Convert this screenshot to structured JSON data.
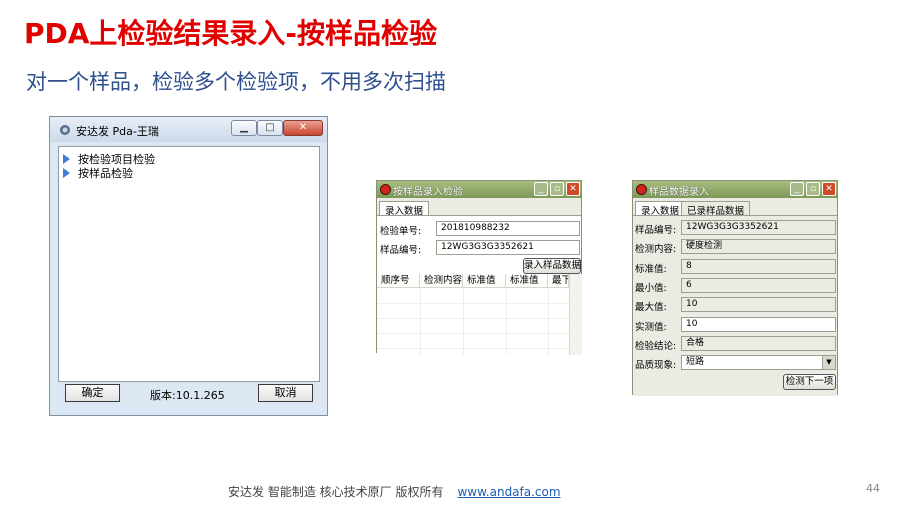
{
  "slide": {
    "title": "PDA上检验结果录入-按样品检验",
    "subtitle": "对一个样品，检验多个检验项，不用多次扫描",
    "footer_text": "安达发   智能制造 核心技术原厂   版权所有",
    "footer_link": "www.andafa.com",
    "page_number": "44"
  },
  "main_window": {
    "title": "安达发 Pda-王瑞",
    "menu_items": [
      {
        "label": "按检验项目检验"
      },
      {
        "label": "按样品检验"
      }
    ],
    "ok_button": "确定",
    "version": "版本:10.1.265",
    "cancel_button": "取消"
  },
  "sample_window": {
    "title": "按样品录入检验",
    "tab_entry": "录入数据",
    "inspection_no_label": "检验单号:",
    "inspection_no_value": "201810988232",
    "sample_no_label": "样品编号:",
    "sample_no_value": "12WG3G3G3352621",
    "entry_button": "录入样品数据",
    "grid_headers": [
      "顺序号",
      "检测内容",
      "标准值",
      "标准值",
      "最下"
    ]
  },
  "data_window": {
    "title": "样品数据录入",
    "tab_entry": "录入数据",
    "tab_entered": "已录样品数据",
    "fields": [
      {
        "label": "样品编号:",
        "value": "12WG3G3G3352621",
        "editable": false
      },
      {
        "label": "检测内容:",
        "value": "硬度检测",
        "editable": false
      },
      {
        "label": "标准值:",
        "value": "8",
        "editable": false
      },
      {
        "label": "最小值:",
        "value": "6",
        "editable": false
      },
      {
        "label": "最大值:",
        "value": "10",
        "editable": false
      },
      {
        "label": "实测值:",
        "value": "10",
        "editable": true
      },
      {
        "label": "检验结论:",
        "value": "合格",
        "editable": false
      }
    ],
    "defect_label": "品质现象:",
    "defect_value": "短路",
    "next_button": "检测下一项"
  },
  "colors": {
    "title_red": "#e00000",
    "subtitle_blue": "#2f4f8f",
    "pda_titlebar": "#cdd9ea",
    "green_titlebar": "#7d9856",
    "link_blue": "#1a5fb4"
  },
  "icons": [
    "app-icon",
    "minimize-icon",
    "maximize-icon",
    "close-icon",
    "expand-triangle-icon",
    "dropdown-arrow-icon"
  ]
}
